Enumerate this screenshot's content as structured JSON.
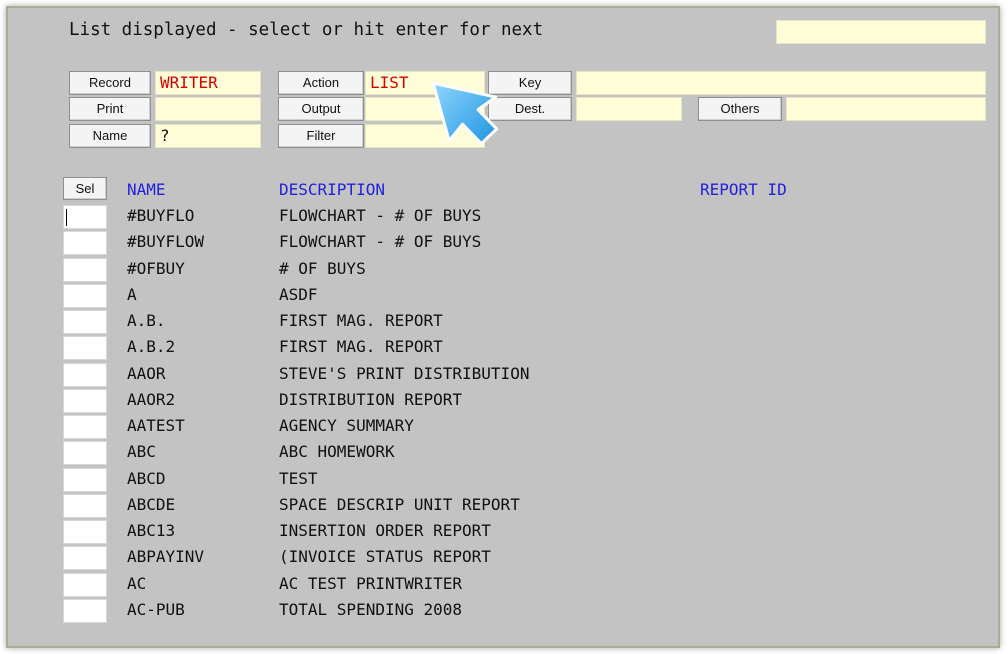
{
  "header": {
    "message": "List displayed - select or hit enter for next",
    "top_right_field": ""
  },
  "form": {
    "record": {
      "label": "Record",
      "value": "WRITER"
    },
    "action": {
      "label": "Action",
      "value": "LIST"
    },
    "key": {
      "label": "Key",
      "value": ""
    },
    "print": {
      "label": "Print",
      "value": ""
    },
    "output": {
      "label": "Output",
      "value": ""
    },
    "dest": {
      "label": "Dest.",
      "value": ""
    },
    "others": {
      "label": "Others",
      "value": ""
    },
    "name": {
      "label": "Name",
      "value": "?"
    },
    "filter": {
      "label": "Filter",
      "value": ""
    }
  },
  "list": {
    "sel_label": "Sel",
    "columns": {
      "name": "NAME",
      "description": "DESCRIPTION",
      "report_id": "REPORT ID"
    },
    "rows": [
      {
        "name": "#BUYFLO",
        "description": "FLOWCHART - # OF BUYS"
      },
      {
        "name": "#BUYFLOW",
        "description": "FLOWCHART - # OF BUYS"
      },
      {
        "name": "#OFBUY",
        "description": "# OF BUYS"
      },
      {
        "name": "A",
        "description": "ASDF"
      },
      {
        "name": "A.B.",
        "description": "FIRST MAG. REPORT"
      },
      {
        "name": "A.B.2",
        "description": "FIRST MAG. REPORT"
      },
      {
        "name": "AAOR",
        "description": "STEVE'S PRINT DISTRIBUTION"
      },
      {
        "name": "AAOR2",
        "description": "DISTRIBUTION REPORT"
      },
      {
        "name": "AATEST",
        "description": "AGENCY SUMMARY"
      },
      {
        "name": "ABC",
        "description": "ABC HOMEWORK"
      },
      {
        "name": "ABCD",
        "description": "TEST"
      },
      {
        "name": "ABCDE",
        "description": "SPACE DESCRIP UNIT REPORT"
      },
      {
        "name": "ABC13",
        "description": "INSERTION ORDER REPORT"
      },
      {
        "name": "ABPAYINV",
        "description": "(INVOICE STATUS REPORT"
      },
      {
        "name": "AC",
        "description": "AC TEST PRINTWRITER"
      },
      {
        "name": "AC-PUB",
        "description": "TOTAL SPENDING 2008"
      }
    ]
  },
  "colors": {
    "header_blue": "#2222dd",
    "value_red": "#d60000",
    "field_bg": "#fffed9",
    "panel_bg": "#c3c3c3",
    "arrow": "#45b3f0"
  },
  "overlay": {
    "pointer": "arrow-callout-icon"
  }
}
